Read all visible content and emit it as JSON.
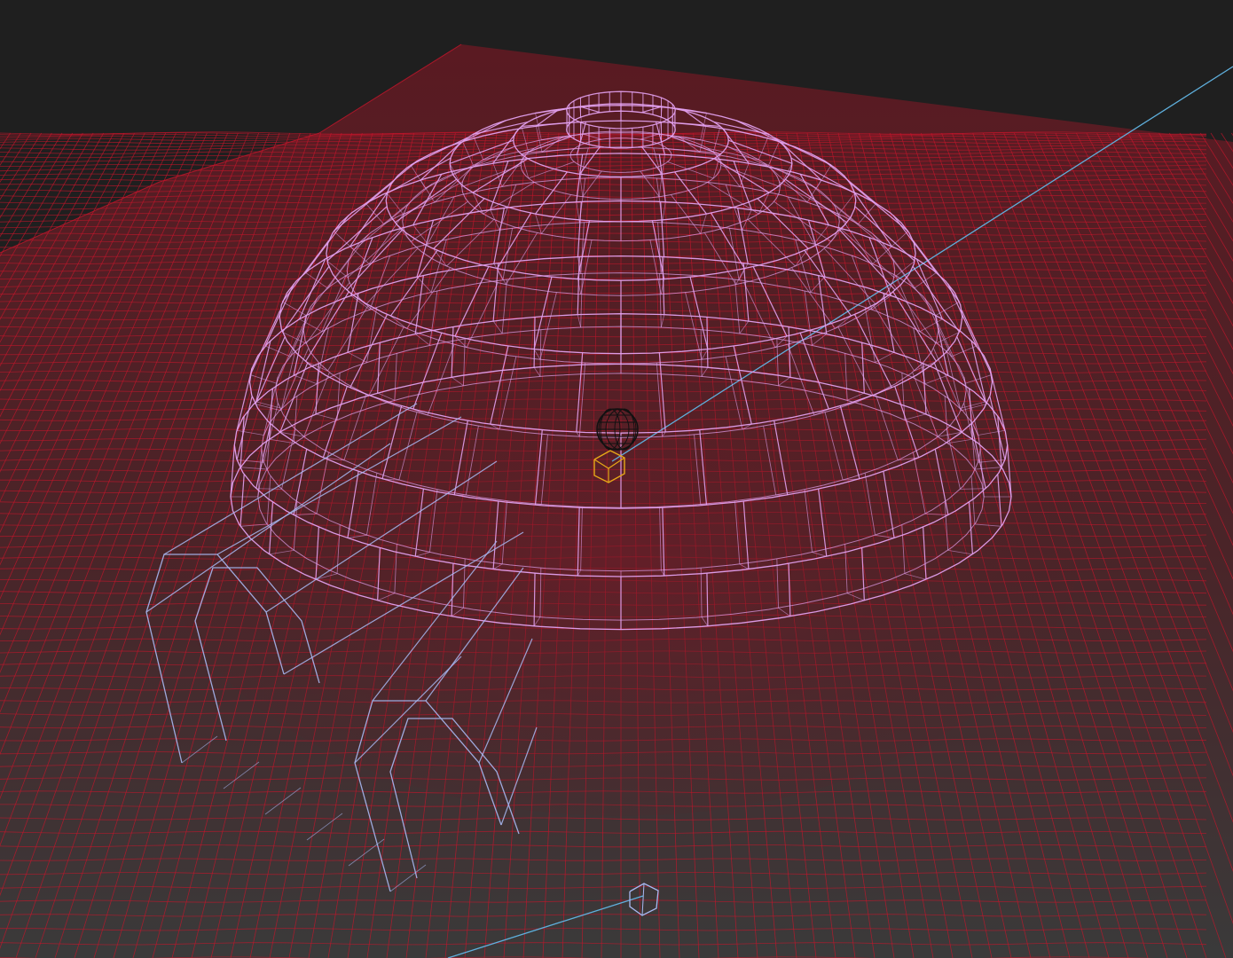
{
  "viewport": {
    "background": "#1f1f1f",
    "ground_fill_top": "#5a1a22",
    "ground_fill_bottom": "#3a3a3a",
    "ground_wire_color": "#c4152b",
    "dome_wire_color": "#e2a0ee",
    "entrance_wire_color": "#a8b8f2",
    "light_line_color": "#5fb0dd",
    "camera_target_color": "#e6a817",
    "omni_light_color": "#111111"
  },
  "scene_objects": [
    {
      "name": "ground-plane",
      "type": "wireframe-mesh"
    },
    {
      "name": "igloo-dome",
      "type": "wireframe-mesh"
    },
    {
      "name": "igloo-entrance-tunnel",
      "type": "wireframe-mesh"
    },
    {
      "name": "omni-light",
      "type": "light-helper"
    },
    {
      "name": "light-target",
      "type": "helper"
    },
    {
      "name": "spot-light",
      "type": "light-helper"
    }
  ]
}
